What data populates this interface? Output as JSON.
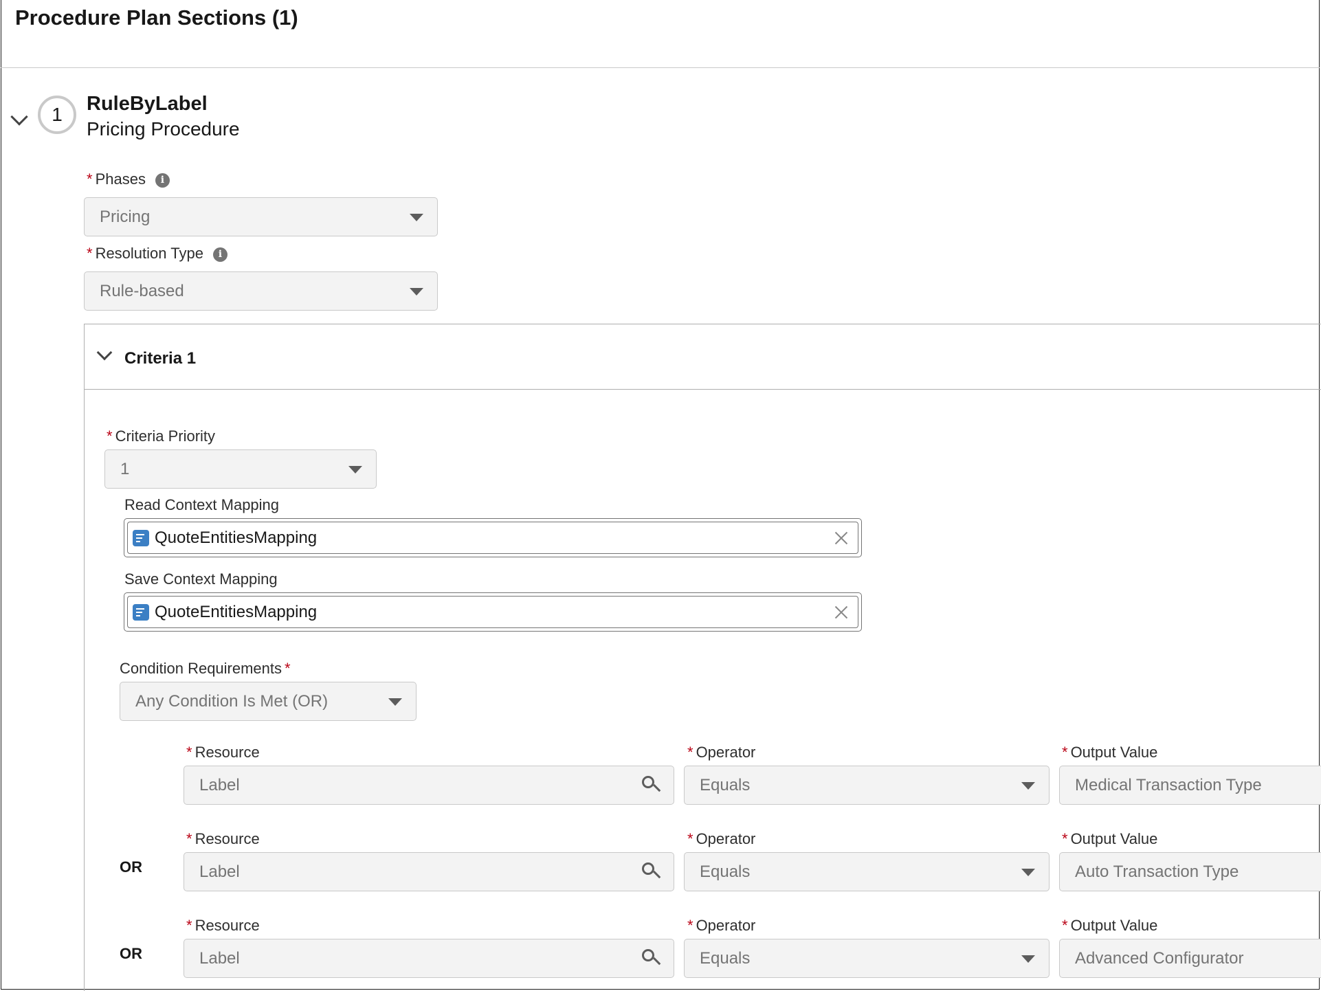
{
  "header": {
    "title": "Procedure Plan Sections (1)"
  },
  "section": {
    "step_number": "1",
    "name": "RuleByLabel",
    "type": "Pricing Procedure",
    "phases": {
      "label": "Phases",
      "value": "Pricing"
    },
    "resolution_type": {
      "label": "Resolution Type",
      "value": "Rule-based"
    }
  },
  "criteria": {
    "title": "Criteria 1",
    "priority": {
      "label": "Criteria Priority",
      "value": "1"
    },
    "read_context": {
      "label": "Read Context Mapping",
      "value": "QuoteEntitiesMapping"
    },
    "save_context": {
      "label": "Save Context Mapping",
      "value": "QuoteEntitiesMapping"
    },
    "condition_requirements": {
      "label": "Condition Requirements",
      "value": "Any Condition Is Met (OR)"
    },
    "labels": {
      "resource": "Resource",
      "operator": "Operator",
      "output": "Output Value"
    },
    "conditions": [
      {
        "connector": "",
        "resource": "Label",
        "operator": "Equals",
        "output": "Medical Transaction Type"
      },
      {
        "connector": "OR",
        "resource": "Label",
        "operator": "Equals",
        "output": "Auto Transaction Type"
      },
      {
        "connector": "OR",
        "resource": "Label",
        "operator": "Equals",
        "output": "Advanced Configurator"
      }
    ]
  },
  "colors": {
    "required": "#ba0517",
    "field_bg": "#f3f3f3",
    "border": "#c9c9c9",
    "mapping_icon": "#3b7fc4"
  }
}
